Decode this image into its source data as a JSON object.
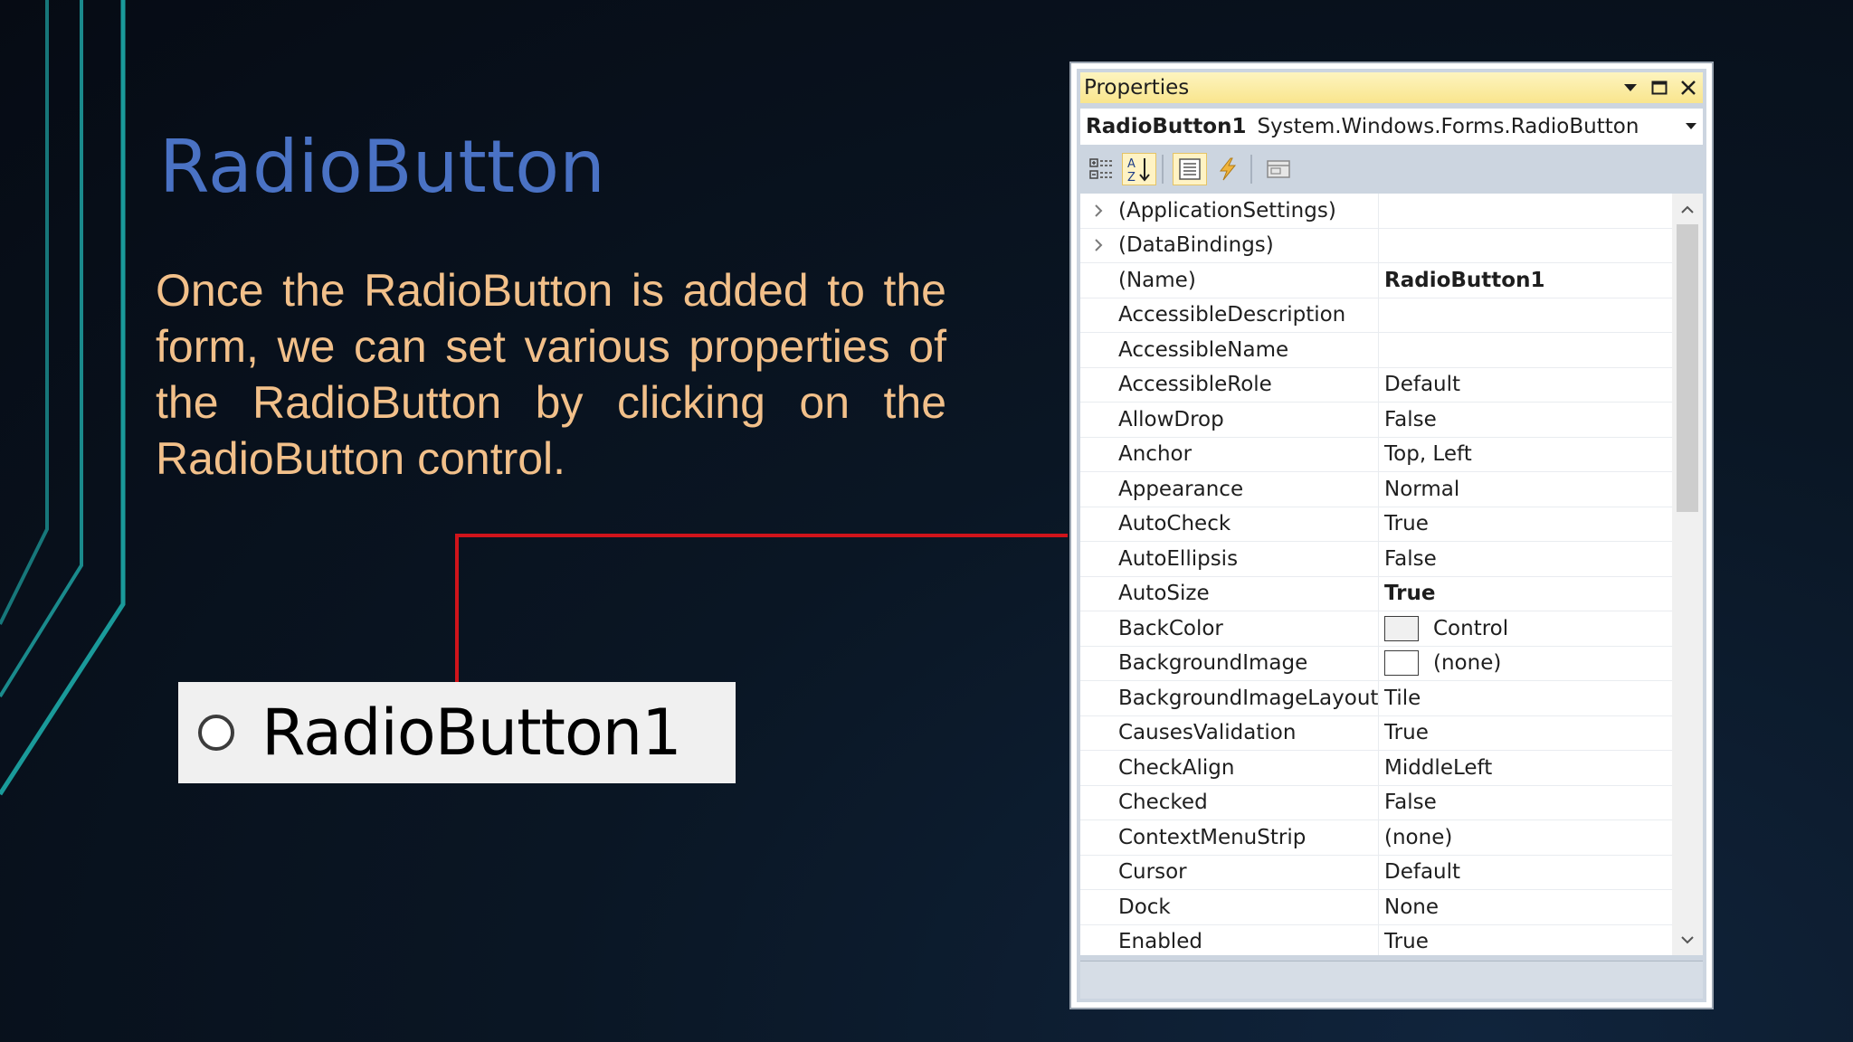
{
  "slide": {
    "title": "RadioButton",
    "body": "Once the RadioButton is added to the form, we can set various properties of the RadioButton by clicking on the RadioButton control.",
    "preview_label": "RadioButton1",
    "accent_color": "#4a72c4",
    "body_color": "#f2c08a",
    "connector_color": "#d0141b"
  },
  "properties": {
    "title": "Properties",
    "object_name": "RadioButton1",
    "object_type": "System.Windows.Forms.RadioButton",
    "toolbar_icons": [
      "categorized-icon",
      "alphabetical-icon",
      "properties-icon",
      "events-icon",
      "property-pages-icon"
    ],
    "rows": [
      {
        "expandable": true,
        "name": "(ApplicationSettings)",
        "value": ""
      },
      {
        "expandable": true,
        "name": "(DataBindings)",
        "value": ""
      },
      {
        "name": "(Name)",
        "value": "RadioButton1",
        "bold": true
      },
      {
        "name": "AccessibleDescription",
        "value": ""
      },
      {
        "name": "AccessibleName",
        "value": ""
      },
      {
        "name": "AccessibleRole",
        "value": "Default"
      },
      {
        "name": "AllowDrop",
        "value": "False"
      },
      {
        "name": "Anchor",
        "value": "Top, Left"
      },
      {
        "name": "Appearance",
        "value": "Normal"
      },
      {
        "name": "AutoCheck",
        "value": "True"
      },
      {
        "name": "AutoEllipsis",
        "value": "False"
      },
      {
        "name": "AutoSize",
        "value": "True",
        "bold": true
      },
      {
        "name": "BackColor",
        "value": "Control",
        "swatch": "#f0f0f0"
      },
      {
        "name": "BackgroundImage",
        "value": "(none)",
        "swatch": "#ffffff"
      },
      {
        "name": "BackgroundImageLayout",
        "value": "Tile"
      },
      {
        "name": "CausesValidation",
        "value": "True"
      },
      {
        "name": "CheckAlign",
        "value": "MiddleLeft"
      },
      {
        "name": "Checked",
        "value": "False"
      },
      {
        "name": "ContextMenuStrip",
        "value": "(none)"
      },
      {
        "name": "Cursor",
        "value": "Default"
      },
      {
        "name": "Dock",
        "value": "None"
      },
      {
        "name": "Enabled",
        "value": "True"
      }
    ]
  }
}
